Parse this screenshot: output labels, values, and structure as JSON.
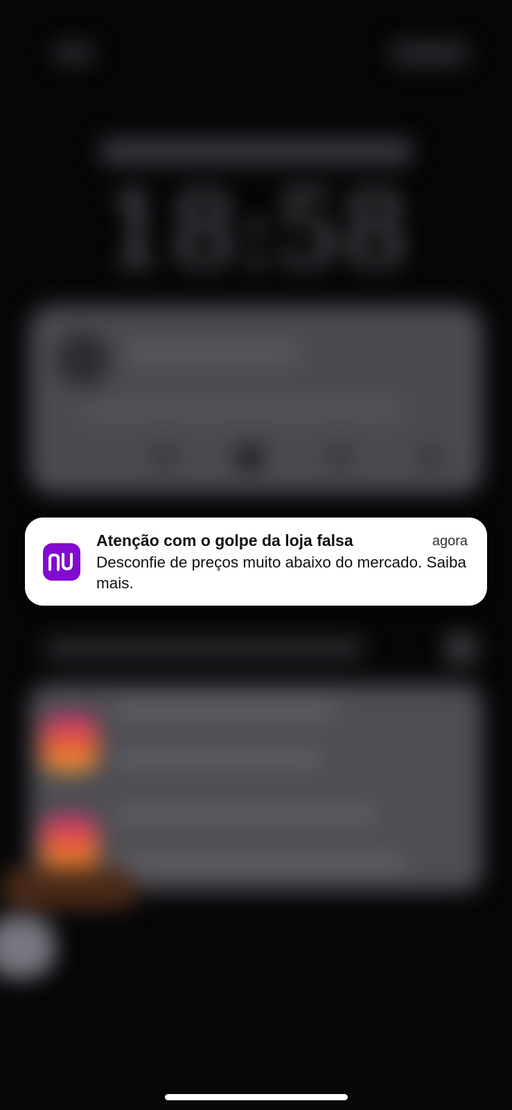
{
  "lock_screen": {
    "clock": "18:58"
  },
  "notification": {
    "app_icon": "nubank-icon",
    "app_icon_text": "nu",
    "title": "Atenção com o golpe da loja falsa",
    "time": "agora",
    "body": "Desconfie de preços muito abaixo do mercado. Saiba mais."
  },
  "colors": {
    "app_brand": "#820ad1",
    "banner_background": "#ffffff",
    "screen_background": "#060608"
  }
}
